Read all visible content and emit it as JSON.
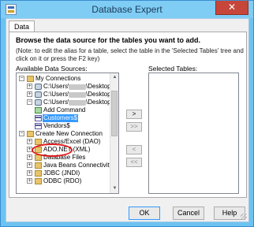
{
  "window": {
    "title": "Database Expert",
    "close_glyph": "✕"
  },
  "tabs": [
    {
      "label": "Data",
      "active": true
    }
  ],
  "panel": {
    "heading": "Browse the data source for the tables you want to add.",
    "note": "(Note: to edit the alias for a table, select the table in the 'Selected Tables' tree and click on it or press the F2 key)",
    "available_label": "Available Data Sources:",
    "selected_label": "Selected Tables:"
  },
  "tree": {
    "items": [
      {
        "label": "My Connections",
        "expander": "−",
        "icon": "folder-icon",
        "level": 0
      },
      {
        "label": "C:\\Users\\",
        "label_tail": "\\Desktop",
        "expander": "+",
        "icon": "database-icon",
        "level": 1
      },
      {
        "label": "C:\\Users\\",
        "label_tail": "\\Desktop",
        "expander": "+",
        "icon": "database-icon",
        "level": 1
      },
      {
        "label": "C:\\Users\\",
        "label_tail": "\\Desktop",
        "expander": "−",
        "icon": "database-icon",
        "level": 1
      },
      {
        "label": "Add Command",
        "icon": "add-command-icon",
        "level": 2
      },
      {
        "label": "Customers$",
        "icon": "table-icon",
        "level": 2,
        "selected": true
      },
      {
        "label": "Vendors$",
        "icon": "table-icon",
        "level": 2
      },
      {
        "label": "Create New Connection",
        "expander": "−",
        "icon": "folder-icon",
        "level": 0
      },
      {
        "label": "Access/Excel (DAO)",
        "expander": "+",
        "icon": "folder-icon",
        "level": 1
      },
      {
        "label": "ADO.NET (XML)",
        "expander": "+",
        "icon": "folder-icon",
        "level": 1
      },
      {
        "label": "Database Files",
        "expander": "+",
        "icon": "folder-icon",
        "level": 1
      },
      {
        "label": "Java Beans Connectivity",
        "expander": "+",
        "icon": "folder-icon",
        "level": 1
      },
      {
        "label": "JDBC (JNDI)",
        "expander": "+",
        "icon": "folder-icon",
        "level": 1
      },
      {
        "label": "ODBC (RDO)",
        "expander": "+",
        "icon": "folder-icon",
        "level": 1
      }
    ]
  },
  "move_buttons": {
    "add_one": ">",
    "add_all": ">>",
    "remove_one": "<",
    "remove_all": "<<"
  },
  "buttons": {
    "ok": "OK",
    "cancel": "Cancel",
    "help": "Help"
  },
  "colors": {
    "selection": "#3399ff",
    "highlight_oval": "#e01a1a",
    "title_bar": "#7fcdf4",
    "close_button": "#c7463a"
  }
}
